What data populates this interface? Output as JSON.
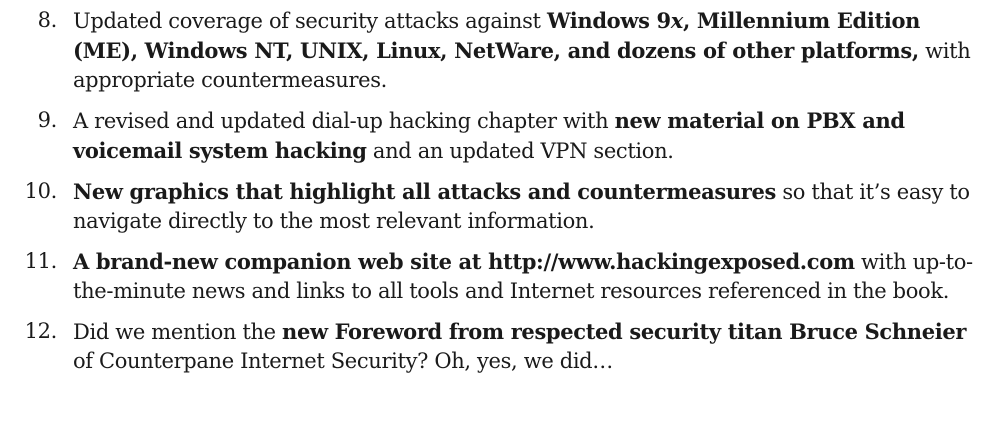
{
  "items": [
    {
      "number": "8.",
      "segments": [
        {
          "text": "Updated coverage of security attacks against ",
          "bold": false
        },
        {
          "text": "Windows 9",
          "bold": true
        },
        {
          "text": "x",
          "bold": true,
          "italic": true
        },
        {
          "text": ", Millennium Edition (ME), Windows NT, UNIX, Linux, NetWare, and dozens of other platforms,",
          "bold": true
        },
        {
          "text": " with appropriate countermeasures.",
          "bold": false
        }
      ]
    },
    {
      "number": "9.",
      "segments": [
        {
          "text": "A revised and updated dial-up hacking chapter with ",
          "bold": false
        },
        {
          "text": "new material on PBX and voicemail system hacking",
          "bold": true
        },
        {
          "text": " and an updated VPN section.",
          "bold": false
        }
      ]
    },
    {
      "number": "10.",
      "segments": [
        {
          "text": "New graphics that highlight all attacks and countermeasures",
          "bold": true
        },
        {
          "text": " so that it’s easy to navigate directly to the most relevant information.",
          "bold": false
        }
      ]
    },
    {
      "number": "11.",
      "segments": [
        {
          "text": "A brand-new companion web site at http://www.hackingexposed.com",
          "bold": true
        },
        {
          "text": " with up-to-the-minute news and links to all tools and Internet resources referenced in the book.",
          "bold": false
        }
      ]
    },
    {
      "number": "12.",
      "segments": [
        {
          "text": "Did we mention the ",
          "bold": false
        },
        {
          "text": "new Foreword from respected security titan Bruce Schneier",
          "bold": true
        },
        {
          "text": " of Counterpane Internet Security? Oh, yes, we did…",
          "bold": false
        }
      ]
    }
  ]
}
